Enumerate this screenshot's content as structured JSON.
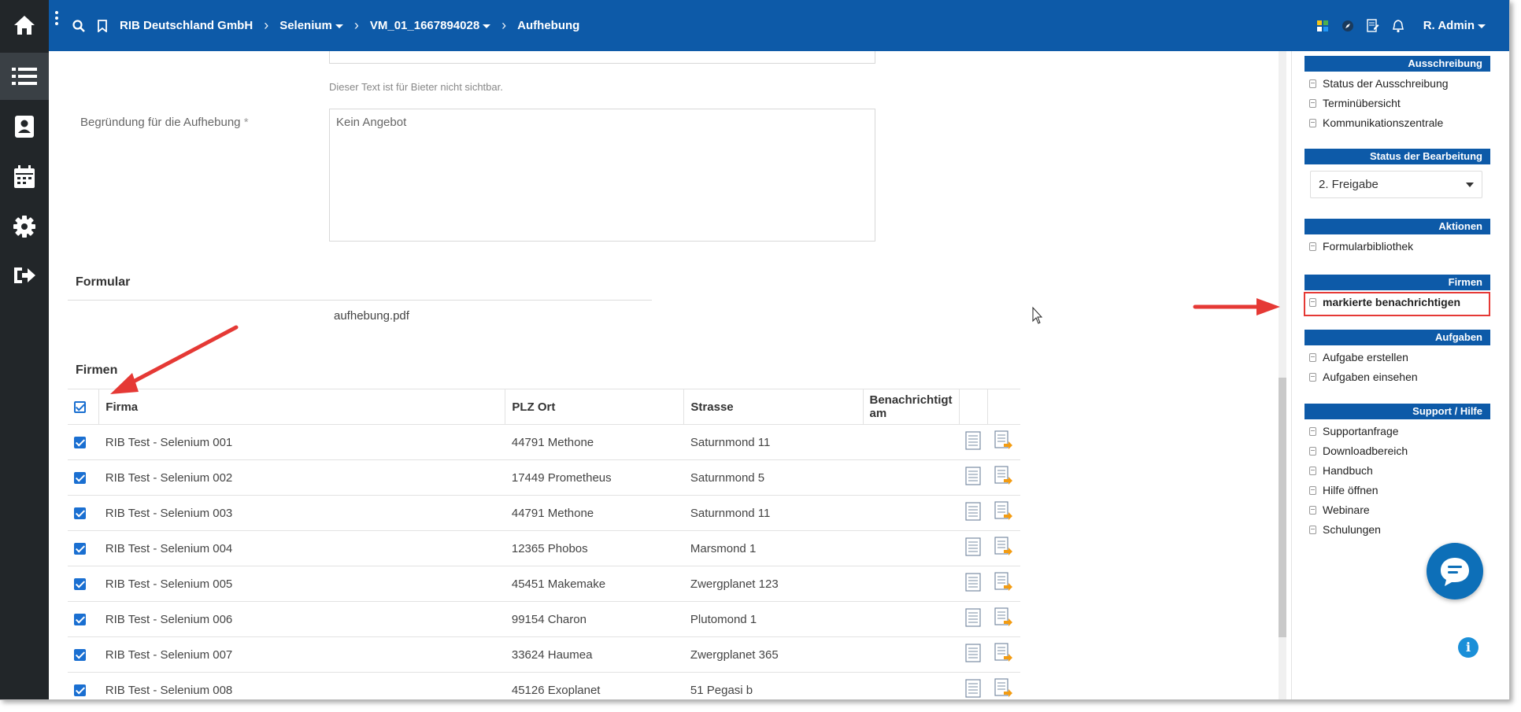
{
  "topbar": {
    "breadcrumbs": [
      {
        "label": "RIB Deutschland GmbH",
        "dropdown": false
      },
      {
        "label": "Selenium",
        "dropdown": true
      },
      {
        "label": "VM_01_1667894028",
        "dropdown": true
      },
      {
        "label": "Aufhebung",
        "dropdown": false
      }
    ],
    "user": "R. Admin"
  },
  "form": {
    "hidden_text_hint": "Dieser Text ist für Bieter nicht sichtbar.",
    "reason_label": "Begründung für die Aufhebung",
    "reason_required_mark": "*",
    "reason_value": "Kein Angebot",
    "formular_title": "Formular",
    "formular_file": "aufhebung.pdf",
    "firms_title": "Firmen"
  },
  "table": {
    "headers": [
      "Firma",
      "PLZ Ort",
      "Strasse",
      "Benachrichtigt am"
    ],
    "rows": [
      {
        "firma": "RIB Test - Selenium 001",
        "plz_ort": "44791 Methone",
        "strasse": "Saturnmond 11",
        "benachrichtigt": ""
      },
      {
        "firma": "RIB Test - Selenium 002",
        "plz_ort": "17449 Prometheus",
        "strasse": "Saturnmond 5",
        "benachrichtigt": ""
      },
      {
        "firma": "RIB Test - Selenium 003",
        "plz_ort": "44791 Methone",
        "strasse": "Saturnmond 11",
        "benachrichtigt": ""
      },
      {
        "firma": "RIB Test - Selenium 004",
        "plz_ort": "12365 Phobos",
        "strasse": "Marsmond 1",
        "benachrichtigt": ""
      },
      {
        "firma": "RIB Test - Selenium 005",
        "plz_ort": "45451 Makemake",
        "strasse": "Zwergplanet 123",
        "benachrichtigt": ""
      },
      {
        "firma": "RIB Test - Selenium 006",
        "plz_ort": "99154 Charon",
        "strasse": "Plutomond 1",
        "benachrichtigt": ""
      },
      {
        "firma": "RIB Test - Selenium 007",
        "plz_ort": "33624 Haumea",
        "strasse": "Zwergplanet 365",
        "benachrichtigt": ""
      },
      {
        "firma": "RIB Test - Selenium 008",
        "plz_ort": "45126 Exoplanet",
        "strasse": "51 Pegasi b",
        "benachrichtigt": ""
      }
    ]
  },
  "rightpanel": {
    "ausschreibung": {
      "title": "Ausschreibung",
      "items": [
        "Status der Ausschreibung",
        "Terminübersicht",
        "Kommunikationszentrale"
      ]
    },
    "status": {
      "title": "Status der Bearbeitung",
      "selected": "2. Freigabe"
    },
    "aktionen": {
      "title": "Aktionen",
      "items": [
        "Formularbibliothek"
      ]
    },
    "firmen": {
      "title": "Firmen",
      "items": [
        "markierte benachrichtigen"
      ]
    },
    "aufgaben": {
      "title": "Aufgaben",
      "items": [
        "Aufgabe erstellen",
        "Aufgaben einsehen"
      ]
    },
    "support": {
      "title": "Support / Hilfe",
      "items": [
        "Supportanfrage",
        "Downloadbereich",
        "Handbuch",
        "Hilfe öffnen",
        "Webinare",
        "Schulungen"
      ]
    }
  },
  "colors": {
    "brand": "#0d5aa8",
    "nav": "#222629",
    "annotation_arrow": "#e53935",
    "checkbox": "#1a6fd1"
  },
  "icons": {
    "nav": [
      "home-icon",
      "list-icon",
      "contacts-icon",
      "calendar-icon",
      "settings-icon",
      "logout-icon"
    ],
    "topbar": [
      "search-icon",
      "bookmark-icon",
      "dashboard-icon",
      "compass-icon",
      "document-edit-icon",
      "bell-icon"
    ]
  }
}
